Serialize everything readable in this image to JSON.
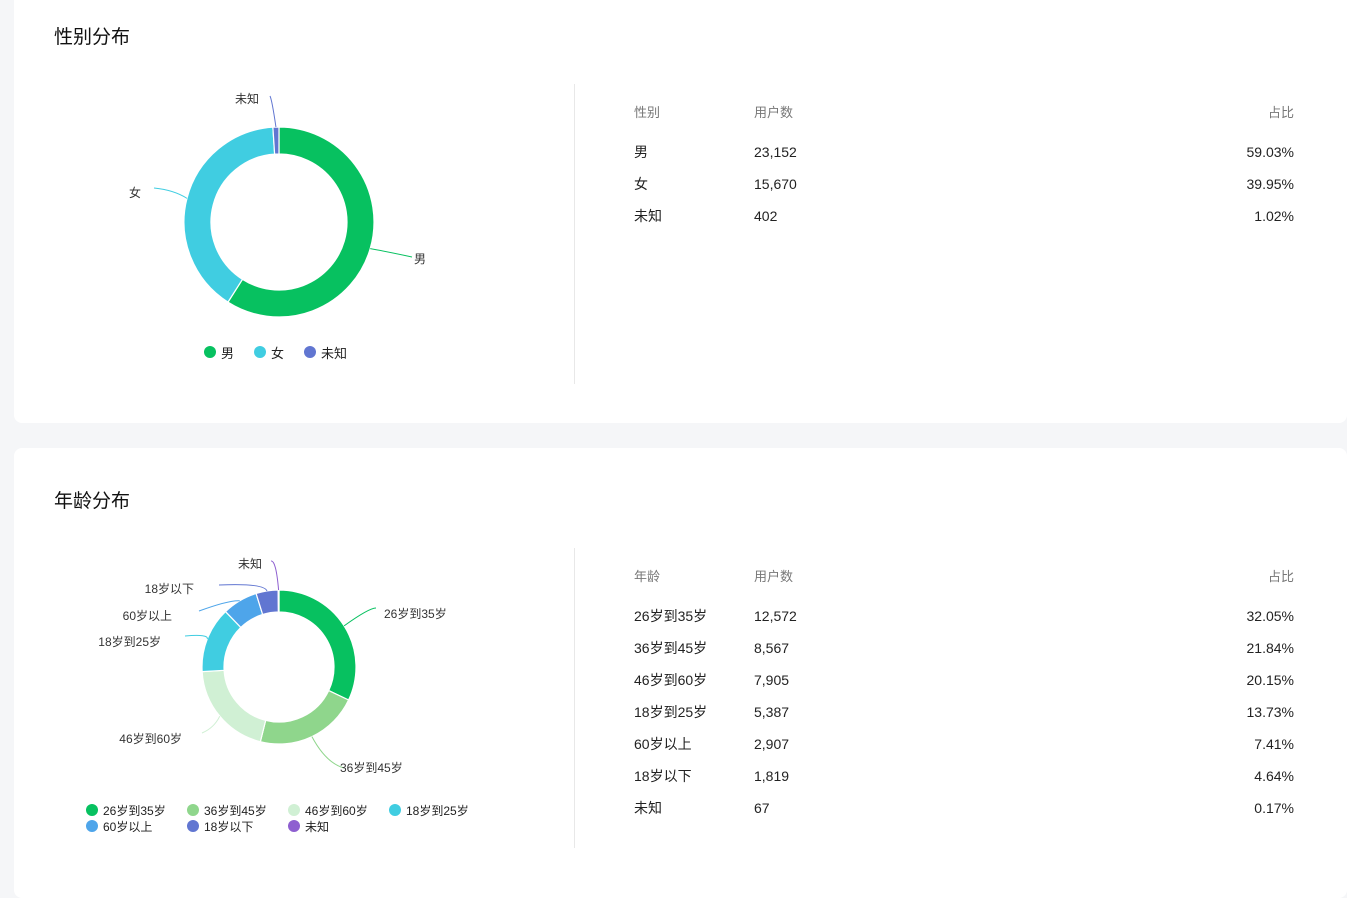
{
  "gender": {
    "title": "性别分布",
    "headers": [
      "性别",
      "用户数",
      "占比"
    ],
    "rows": [
      {
        "label": "男",
        "count": "23,152",
        "pct": "59.03%",
        "value": 23152,
        "color": "#07c160"
      },
      {
        "label": "女",
        "count": "15,670",
        "pct": "39.95%",
        "value": 15670,
        "color": "#40cde1"
      },
      {
        "label": "未知",
        "count": "402",
        "pct": "1.02%",
        "value": 402,
        "color": "#6176d1"
      }
    ]
  },
  "age": {
    "title": "年龄分布",
    "headers": [
      "年龄",
      "用户数",
      "占比"
    ],
    "rows": [
      {
        "label": "26岁到35岁",
        "count": "12,572",
        "pct": "32.05%",
        "value": 12572,
        "color": "#07c160"
      },
      {
        "label": "36岁到45岁",
        "count": "8,567",
        "pct": "21.84%",
        "value": 8567,
        "color": "#8fd68c"
      },
      {
        "label": "46岁到60岁",
        "count": "7,905",
        "pct": "20.15%",
        "value": 7905,
        "color": "#d0f0d4"
      },
      {
        "label": "18岁到25岁",
        "count": "5,387",
        "pct": "13.73%",
        "value": 5387,
        "color": "#40cde1"
      },
      {
        "label": "60岁以上",
        "count": "2,907",
        "pct": "7.41%",
        "value": 2907,
        "color": "#4ea5ea"
      },
      {
        "label": "18岁以下",
        "count": "1,819",
        "pct": "4.64%",
        "value": 1819,
        "color": "#6176d1"
      },
      {
        "label": "未知",
        "count": "67",
        "pct": "0.17%",
        "value": 67,
        "color": "#8e5fd0"
      }
    ]
  }
}
